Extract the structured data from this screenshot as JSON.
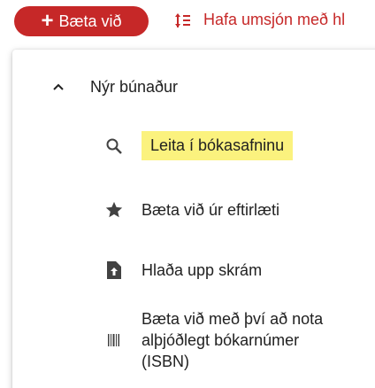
{
  "topbar": {
    "add_button_label": "Bæta við",
    "manage_label": "Hafa umsjón með hl"
  },
  "menu": {
    "section_title": "Nýr búnaður",
    "items": [
      {
        "label": "Leita í bókasafninu",
        "icon": "search-icon",
        "highlighted": true
      },
      {
        "label": "Bæta við úr eftirlæti",
        "icon": "star-icon"
      },
      {
        "label": "Hlaða upp skrám",
        "icon": "file-upload-icon"
      },
      {
        "label": "Bæta við með því að nota alþjóðlegt bókarnúmer (ISBN)",
        "icon": "barcode-icon"
      }
    ]
  },
  "colors": {
    "accent": "#c62828",
    "highlight": "#fbf27e"
  }
}
